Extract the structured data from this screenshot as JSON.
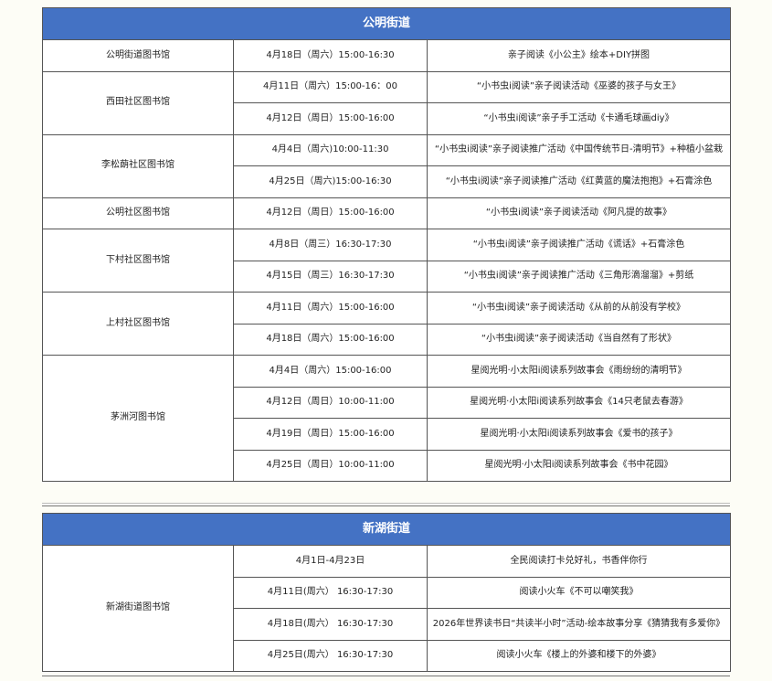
{
  "sections": [
    {
      "title": "公明街道",
      "groups": [
        {
          "library": "公明街道图书馆",
          "events": [
            {
              "time": "4月18日（周六）15:00-16:30",
              "activity": "亲子阅读《小公主》绘本+DIY拼图"
            }
          ]
        },
        {
          "library": "西田社区图书馆",
          "events": [
            {
              "time": "4月11日（周六）15:00-16：00",
              "activity": "“小书虫i阅读”亲子阅读活动《巫婆的孩子与女王》"
            },
            {
              "time": "4月12日（周日）15:00-16:00",
              "activity": "“小书虫i阅读”亲子手工活动《卡通毛球画diy》"
            }
          ]
        },
        {
          "library": "李松蓢社区图书馆",
          "events": [
            {
              "time": "4月4日（周六)10:00-11:30",
              "activity": "“小书虫i阅读”亲子阅读推广活动《中国传统节日-清明节》+种植小盆栽"
            },
            {
              "time": "4月25日（周六)15:00-16:30",
              "activity": "“小书虫i阅读”亲子阅读推广活动《红黄蓝的魔法抱抱》+石膏涂色"
            }
          ]
        },
        {
          "library": "公明社区图书馆",
          "events": [
            {
              "time": "4月12日（周日）15:00-16:00",
              "activity": "“小书虫i阅读”亲子阅读活动《阿凡提的故事》"
            }
          ]
        },
        {
          "library": "下村社区图书馆",
          "events": [
            {
              "time": "4月8日（周三）16:30-17:30",
              "activity": "“小书虫i阅读”亲子阅读推广活动《谎话》+石膏涂色"
            },
            {
              "time": "4月15日（周三）16:30-17:30",
              "activity": "“小书虫i阅读”亲子阅读推广活动《三角形滴溜溜》+剪纸"
            }
          ]
        },
        {
          "library": "上村社区图书馆",
          "events": [
            {
              "time": "4月11日（周六）15:00-16:00",
              "activity": "“小书虫i阅读”亲子阅读活动《从前的从前没有学校》"
            },
            {
              "time": "4月18日（周六）15:00-16:00",
              "activity": "“小书虫i阅读”亲子阅读活动《当自然有了形状》"
            }
          ]
        },
        {
          "library": "茅洲河图书馆",
          "events": [
            {
              "time": "4月4日（周六）15:00-16:00",
              "activity": "星阅光明·小太阳i阅读系列故事会《雨纷纷的清明节》"
            },
            {
              "time": "4月12日（周日）10:00-11:00",
              "activity": "星阅光明·小太阳i阅读系列故事会《14只老鼠去春游》"
            },
            {
              "time": "4月19日（周日）15:00-16:00",
              "activity": "星阅光明·小太阳i阅读系列故事会《爱书的孩子》"
            },
            {
              "time": "4月25日（周日）10:00-11:00",
              "activity": "星阅光明·小太阳i阅读系列故事会《书中花园》"
            }
          ]
        }
      ]
    },
    {
      "title": "新湖街道",
      "groups": [
        {
          "library": "新湖街道图书馆",
          "events": [
            {
              "time": "4月1日-4月23日",
              "activity": "全民阅读打卡兑好礼，书香伴你行"
            },
            {
              "time": "4月11日(周六） 16:30-17:30",
              "activity": "阅读小火车《不可以嘲笑我》"
            },
            {
              "time": "4月18日(周六） 16:30-17:30",
              "activity": "2026年世界读书日“共读半小时”活动-绘本故事分享《猜猜我有多爱你》"
            },
            {
              "time": "4月25日(周六） 16:30-17:30",
              "activity": "阅读小火车《楼上的外婆和楼下的外婆》"
            }
          ]
        }
      ]
    }
  ]
}
